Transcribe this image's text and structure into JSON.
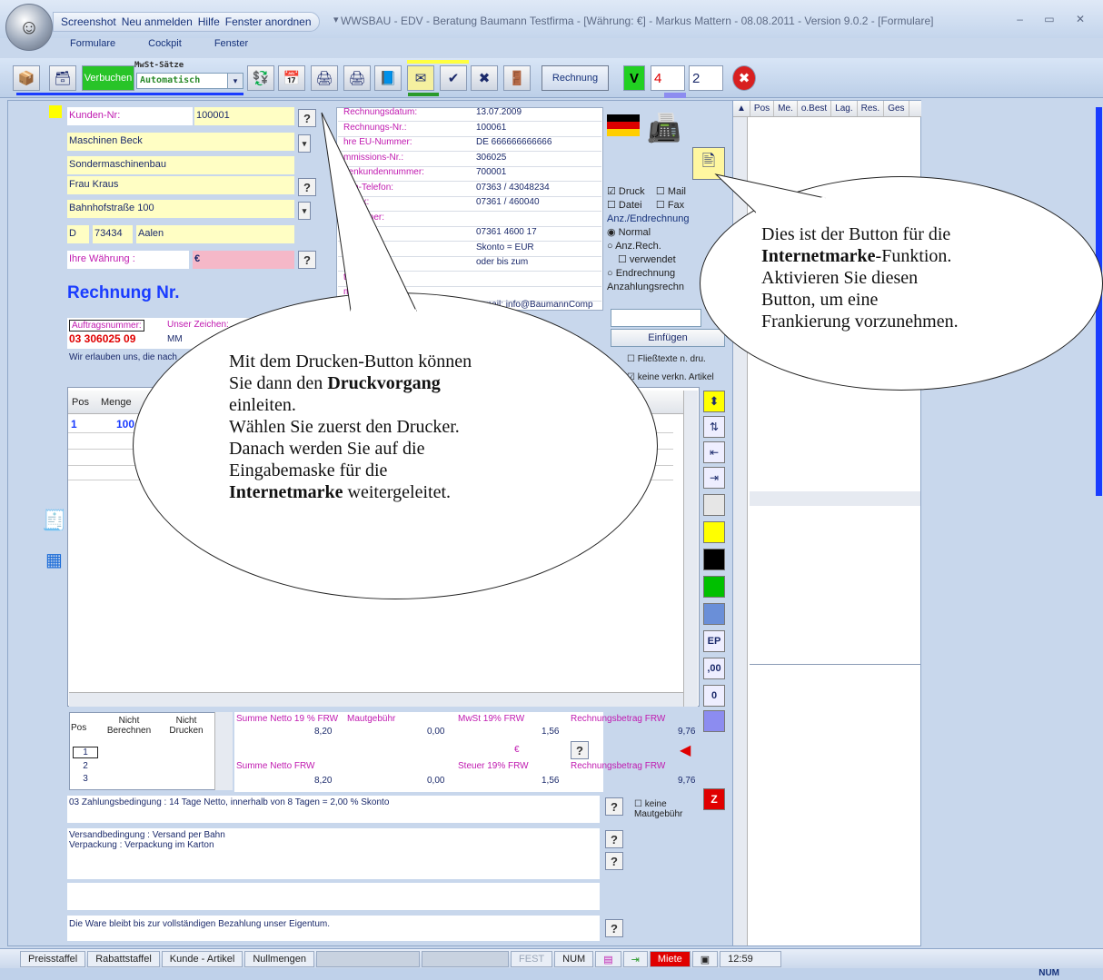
{
  "titlebar": {
    "qat_items": [
      "Screenshot",
      "Neu anmelden",
      "Hilfe",
      "Fenster anordnen"
    ],
    "title": "WWSBAU - EDV - Beratung Baumann Testfirma - [Währung: €] -   Markus Mattern - 08.08.2011 - Version 9.0.2  - [Formulare]",
    "window_controls": "– ▭ ✕"
  },
  "menu": [
    "Formulare",
    "Cockpit",
    "Fenster"
  ],
  "toolbar": {
    "verbuchen_label": "Verbuchen",
    "mwst_label": "MwSt-Sätze",
    "mwst_value": "Automatisch",
    "rechnung_label": "Rechnung",
    "v_label": "V",
    "num1": "4",
    "num2": "2"
  },
  "customer": {
    "kunden_nr_label": "Kunden-Nr:",
    "kunden_nr": "100001",
    "name": "Maschinen Beck",
    "name2": "Sondermaschinenbau",
    "contact": "Frau Kraus",
    "street": "Bahnhofstraße 100",
    "country": "D",
    "zip": "73434",
    "city": "Aalen",
    "waehrung_label": "Ihre Währung :",
    "waehrung": "€"
  },
  "invoice_info": {
    "rows": [
      {
        "label": "Rechnungsdatum:",
        "value": "13.07.2009"
      },
      {
        "label": "Rechnungs-Nr.:",
        "value": "100061"
      },
      {
        "label": "hre EU-Nummer:",
        "value": "DE 666666666666"
      },
      {
        "label": "mmissions-Nr.:",
        "value": "306025"
      },
      {
        "label": "genkundennummer:",
        "value": "700001"
      },
      {
        "label": "den-Telefon:",
        "value": "07363 / 43048234"
      },
      {
        "label": "n-Fax:",
        "value": "07361 / 460040"
      },
      {
        "label": "chpartner:",
        "value": ""
      },
      {
        "label": "l:",
        "value": "07361 4600 17"
      },
      {
        "label": "hrift:",
        "value": "Skonto = EUR"
      },
      {
        "label": "um",
        "value": "oder bis zum"
      },
      {
        "label": "tum:",
        "value": ""
      },
      {
        "label": "mmer:",
        "value": ""
      }
    ],
    "email": "e-mail: info@BaumannComp"
  },
  "options": {
    "druck": "Druck",
    "mail": "Mail",
    "datei": "Datei",
    "fax": "Fax",
    "group_title": "Anz./Endrechnung",
    "normal": "Normal",
    "anz_rech": "Anz.Rech.",
    "verwendet": "verwendet",
    "endrechnung": "Endrechnung",
    "anzahlung_label": "Anzahlungsrechn",
    "einfuegen": "Einfügen",
    "fliesstexte": "Fließtexte n. dru.",
    "keine_verkn": "keine verkn. Artikel"
  },
  "document": {
    "heading": "Rechnung  Nr.",
    "auftrag_label": "Auftragsnummer:",
    "auftrag_value": "03 306025 09",
    "zeichen_label": "Unser Zeichen:",
    "zeichen_value": "MM",
    "intro": "Wir erlauben uns, die nach"
  },
  "positions": {
    "headers": [
      "Pos",
      "Menge"
    ],
    "rows": [
      {
        "pos": "1",
        "menge": "100"
      }
    ]
  },
  "side_buttons": {
    "ep": "EP",
    "dec": ",00",
    "zero": "0",
    "z": "Z"
  },
  "colors": {
    "yellow": "#ffff00",
    "black": "#000000",
    "green": "#00c000",
    "blue": "#6a8fd8",
    "lilac": "#8c8cf0",
    "accent_red": "#e00000",
    "accent_blue": "#1a3cff"
  },
  "totals": {
    "table_headers": [
      "Pos",
      "Nicht Berechnen",
      "Nicht Drucken"
    ],
    "table_rows": [
      "1",
      "2",
      "3"
    ],
    "summe_netto_19_label": "Summe Netto 19 % FRW",
    "summe_netto_19": "8,20",
    "maut_label": "Mautgebühr",
    "maut": "0,00",
    "mwst_label": "MwSt 19% FRW",
    "mwst": "1,56",
    "betrag_label": "Rechnungsbetrag FRW",
    "betrag": "9,76",
    "euro": "€",
    "summe_netto_label": "Summe Netto FRW",
    "summe_netto": "8,20",
    "maut2": "0,00",
    "steuer_label": "Steuer 19% FRW",
    "steuer": "1,56",
    "betrag2_label": "Rechnungsbetrag FRW",
    "betrag2": "9,76"
  },
  "terms": {
    "zahlung": "03  Zahlungsbedingung   : 14 Tage Netto, innerhalb von 8 Tagen = 2,00 % Skonto",
    "keine_maut": "keine Mautgebühr",
    "versand": "Versandbedingung   : Versand per Bahn",
    "verpackung": "Verpackung            : Verpackung im Karton",
    "eigentum": "Die Ware bleibt bis zur vollständigen Bezahlung unser Eigentum."
  },
  "right_panel": {
    "headers": [
      "Pos",
      "Me.",
      "o.Best",
      "Lag.",
      "Res.",
      "Ges"
    ]
  },
  "callouts": {
    "left": {
      "line1": "Mit dem Drucken-Button können",
      "line2a": "Sie dann den ",
      "line2b": "Druckvorgang",
      "line3": "einleiten.",
      "line4": "Wählen Sie zuerst den Drucker.",
      "line5": "Danach werden Sie auf die",
      "line6": "Eingabemaske für die",
      "line7a": "Internetmarke",
      "line7b": " weitergeleitet."
    },
    "right": {
      "line1": "Dies ist der Button für die",
      "line2a": "Internetmarke",
      "line2b": "-Funktion.",
      "line3": "Aktivieren Sie diesen",
      "line4": "Button, um eine",
      "line5": "Frankierung vorzunehmen."
    }
  },
  "statusbar": {
    "items": [
      "Preisstaffel",
      "Rabattstaffel",
      "Kunde - Artikel",
      "Nullmengen"
    ],
    "fest": "FEST",
    "num": "NUM",
    "miete": "Miete",
    "time": "12:59",
    "bottom_num": "NUM"
  }
}
